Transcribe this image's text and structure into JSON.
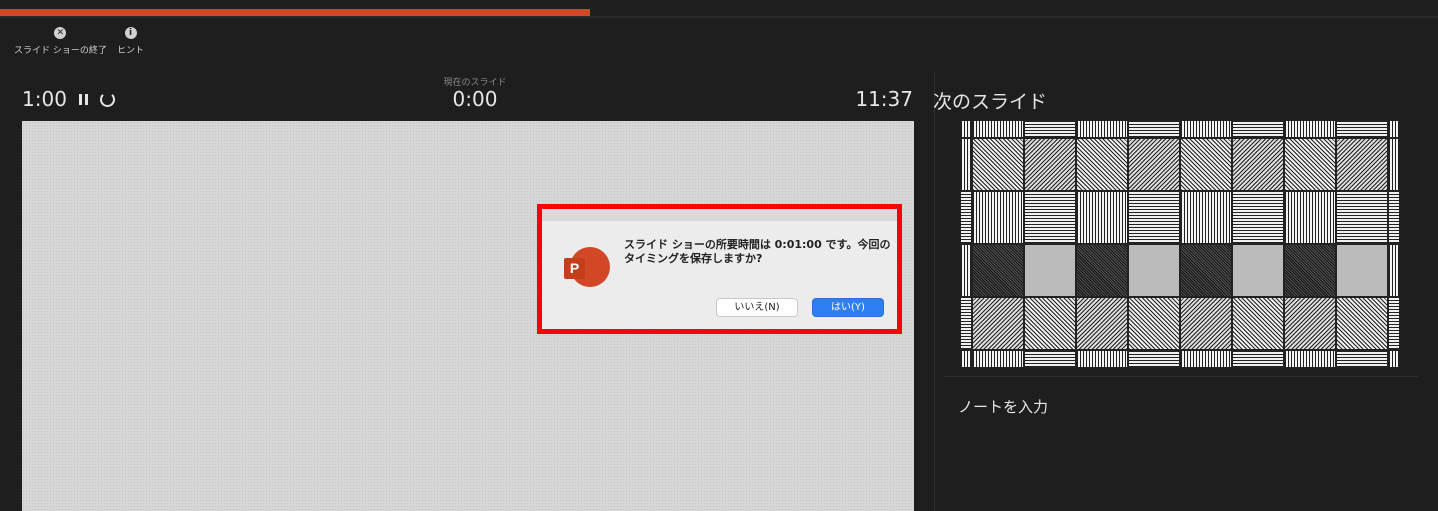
{
  "progress": {
    "percent": 41,
    "color": "#d24726"
  },
  "toolbar": {
    "end_label": "スライド ショーの終了",
    "hint_label": "ヒント",
    "end_icon": "close-circle-icon",
    "hint_icon": "info-icon"
  },
  "timer": {
    "elapsed": "1:00"
  },
  "current_slide": {
    "label": "現在のスライド",
    "time": "0:00"
  },
  "clock": "11:37",
  "next_slide": {
    "title": "次のスライド"
  },
  "notes": {
    "placeholder": "ノートを入力"
  },
  "dialog": {
    "message": "スライド ショーの所要時間は 0:01:00 です。今回のタイミングを保存しますか?",
    "app_icon_letter": "P",
    "no_label": "いいえ(N)",
    "yes_label": "はい(Y)",
    "highlight_color": "#ff0000"
  }
}
